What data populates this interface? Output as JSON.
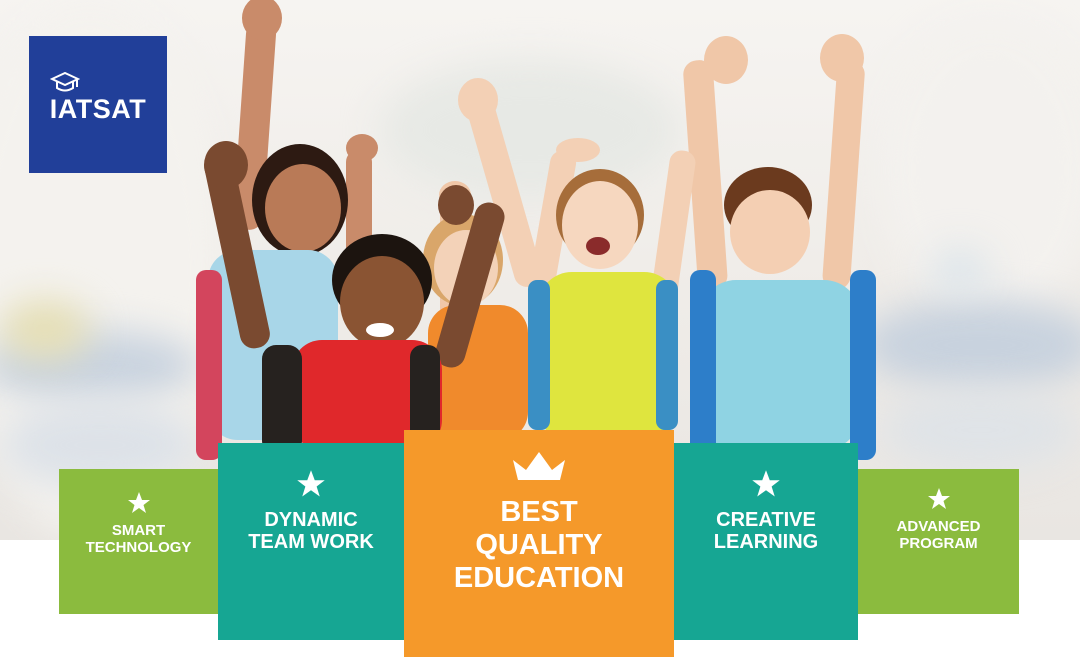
{
  "logo": {
    "text": "IATSAT",
    "icon": "graduation-cap-icon"
  },
  "features": [
    {
      "label_lines": [
        "SMART",
        "TECHNOLOGY"
      ],
      "icon": "star-icon",
      "color": "#8bbb3e"
    },
    {
      "label_lines": [
        "DYNAMIC",
        "TEAM WORK"
      ],
      "icon": "star-icon",
      "color": "#16a693"
    },
    {
      "label_lines": [
        "BEST",
        "QUALITY",
        "EDUCATION"
      ],
      "icon": "crown-icon",
      "color": "#f5992a"
    },
    {
      "label_lines": [
        "CREATIVE",
        "LEARNING"
      ],
      "icon": "star-icon",
      "color": "#16a693"
    },
    {
      "label_lines": [
        "ADVANCED",
        "PROGRAM"
      ],
      "icon": "star-icon",
      "color": "#8bbb3e"
    }
  ],
  "colors": {
    "logo_bg": "#213f99",
    "green": "#8bbb3e",
    "teal": "#16a693",
    "orange": "#f5992a"
  }
}
